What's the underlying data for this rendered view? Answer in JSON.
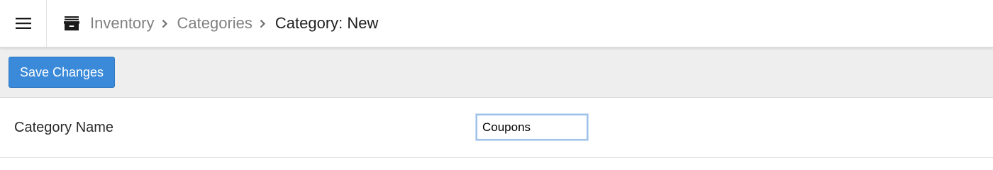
{
  "header": {
    "menu_icon": "hamburger-menu-icon",
    "section_icon": "archive-box-icon",
    "breadcrumb": {
      "items": [
        "Inventory",
        "Categories"
      ],
      "separator_icon": "chevron-right-icon",
      "current": "Category: New"
    }
  },
  "toolbar": {
    "save_label": "Save Changes"
  },
  "form": {
    "category_name": {
      "label": "Category Name",
      "value": "Coupons"
    }
  },
  "colors": {
    "primary_button": "#3a8ad9",
    "toolbar_bg": "#eeeeee",
    "breadcrumb_link": "#808080",
    "input_focus_border": "#9ec2ea"
  }
}
